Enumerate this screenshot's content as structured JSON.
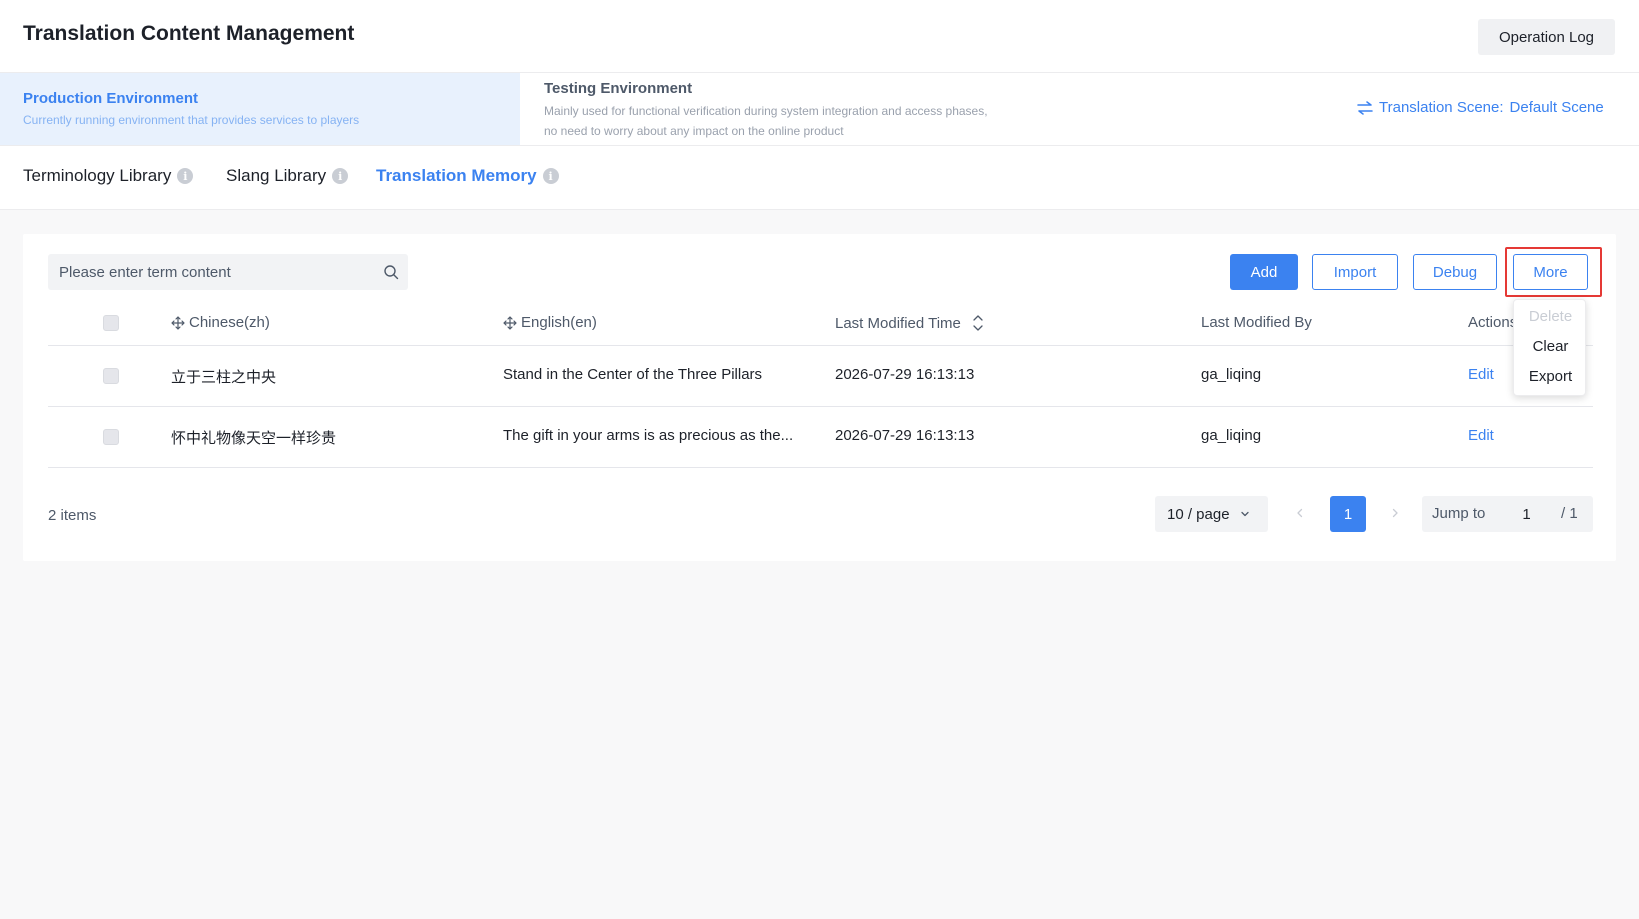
{
  "header": {
    "title": "Translation Content Management",
    "operation_log": "Operation Log"
  },
  "environments": {
    "production": {
      "title": "Production Environment",
      "description": "Currently running environment that provides services to players"
    },
    "testing": {
      "title": "Testing Environment",
      "description": "Mainly used for functional verification during system integration and access phases, no need to worry about any impact on the online product"
    },
    "scene": {
      "label": "Translation Scene:",
      "value": "Default Scene"
    }
  },
  "tabs": [
    {
      "label": "Terminology Library",
      "active": false
    },
    {
      "label": "Slang Library",
      "active": false
    },
    {
      "label": "Translation Memory",
      "active": true
    }
  ],
  "toolbar": {
    "search_placeholder": "Please enter term content",
    "add": "Add",
    "import": "Import",
    "debug": "Debug",
    "more": "More"
  },
  "more_menu": [
    {
      "label": "Delete",
      "disabled": true
    },
    {
      "label": "Clear",
      "disabled": false
    },
    {
      "label": "Export",
      "disabled": false
    }
  ],
  "table": {
    "columns": [
      "Chinese(zh)",
      "English(en)",
      "Last Modified Time",
      "Last Modified By",
      "Actions"
    ],
    "rows": [
      {
        "zh": "立于三柱之中央",
        "en": "Stand in the Center of the Three Pillars",
        "modified_time": "2026-07-29 16:13:13",
        "modified_by": "ga_liqing",
        "action": "Edit"
      },
      {
        "zh": "怀中礼物像天空一样珍贵",
        "en": "The gift in your arms is as precious as the...",
        "modified_time": "2026-07-29 16:13:13",
        "modified_by": "ga_liqing",
        "action": "Edit"
      }
    ]
  },
  "pagination": {
    "total": "2 items",
    "page_size": "10 / page",
    "current_page": "1",
    "jump_label": "Jump to",
    "jump_value": "1",
    "total_pages": "/ 1"
  },
  "colors": {
    "accent": "#3b82f0",
    "highlight": "#e53935"
  }
}
